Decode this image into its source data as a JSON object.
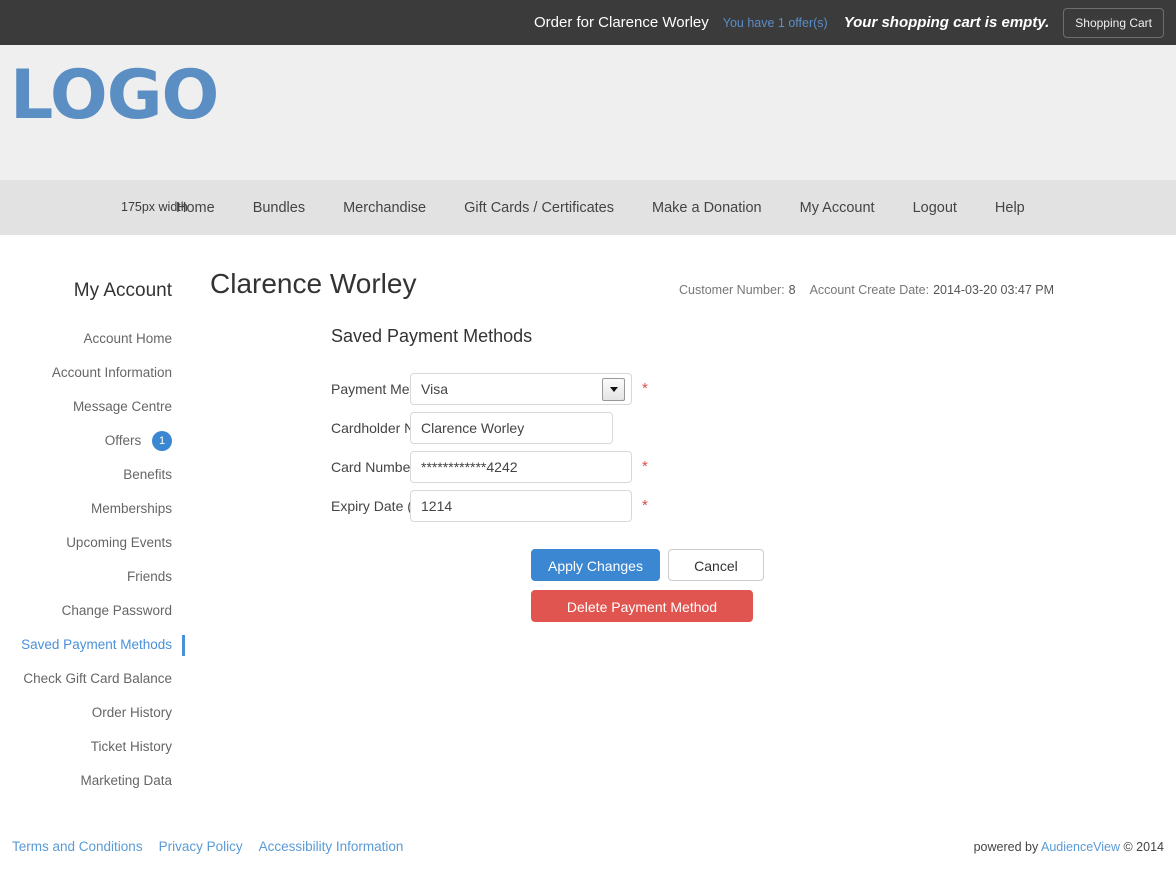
{
  "topbar": {
    "order_for": "Order for Clarence Worley",
    "offers_link": "You have 1 offer(s)",
    "cart_message": "Your shopping cart is empty.",
    "cart_button": "Shopping Cart"
  },
  "branding": {
    "logo_text": "LOGO",
    "logo_caption": "175px width",
    "logo_color": "#5b8fc4"
  },
  "nav": {
    "items": [
      {
        "label": "Home"
      },
      {
        "label": "Bundles"
      },
      {
        "label": "Merchandise"
      },
      {
        "label": "Gift Cards / Certificates"
      },
      {
        "label": "Make a Donation"
      },
      {
        "label": "My Account"
      },
      {
        "label": "Logout"
      },
      {
        "label": "Help"
      }
    ]
  },
  "sidebar": {
    "title": "My Account",
    "items": [
      {
        "label": "Account Home",
        "badge": null,
        "active": false
      },
      {
        "label": "Account Information",
        "badge": null,
        "active": false
      },
      {
        "label": "Message Centre",
        "badge": null,
        "active": false
      },
      {
        "label": "Offers",
        "badge": "1",
        "active": false
      },
      {
        "label": "Benefits",
        "badge": null,
        "active": false
      },
      {
        "label": "Memberships",
        "badge": null,
        "active": false
      },
      {
        "label": "Upcoming Events",
        "badge": null,
        "active": false
      },
      {
        "label": "Friends",
        "badge": null,
        "active": false
      },
      {
        "label": "Change Password",
        "badge": null,
        "active": false
      },
      {
        "label": "Saved Payment Methods",
        "badge": null,
        "active": true
      },
      {
        "label": "Check Gift Card Balance",
        "badge": null,
        "active": false
      },
      {
        "label": "Order History",
        "badge": null,
        "active": false
      },
      {
        "label": "Ticket History",
        "badge": null,
        "active": false
      },
      {
        "label": "Marketing Data",
        "badge": null,
        "active": false
      }
    ]
  },
  "main": {
    "customer_name": "Clarence Worley",
    "customer_number_label": "Customer Number:",
    "customer_number_value": "8",
    "account_create_date_label": "Account Create Date:",
    "account_create_date_value": "2014-03-20 03:47 PM",
    "section_title": "Saved Payment Methods"
  },
  "form": {
    "payment_method": {
      "label": "Payment Method",
      "value": "Visa",
      "options": [
        "Visa"
      ],
      "required": true
    },
    "cardholder_name": {
      "label": "Cardholder Name",
      "value": "Clarence Worley",
      "required": false
    },
    "card_number": {
      "label": "Card Number",
      "value": "************4242",
      "required": true
    },
    "expiry_date": {
      "label": "Expiry Date (MMYY)",
      "value": "1214",
      "required": true
    },
    "required_marker": "*"
  },
  "actions": {
    "apply": "Apply Changes",
    "cancel": "Cancel",
    "delete": "Delete Payment Method"
  },
  "footer": {
    "links": [
      {
        "label": "Terms and Conditions"
      },
      {
        "label": "Privacy Policy"
      },
      {
        "label": "Accessibility Information"
      }
    ],
    "powered_by": "powered by",
    "brand": "AudienceView",
    "copyright": "© 2014"
  }
}
